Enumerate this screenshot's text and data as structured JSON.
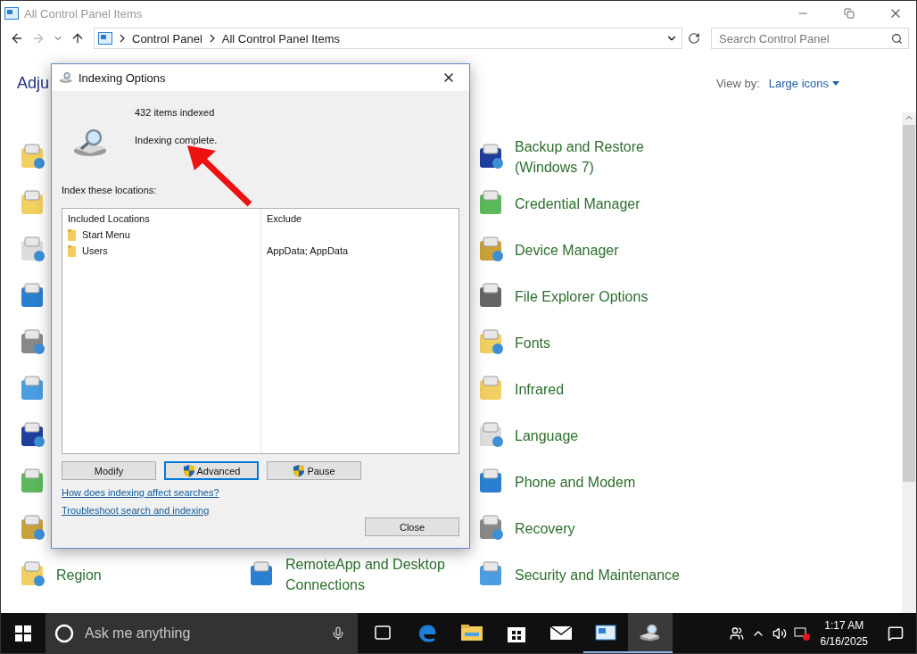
{
  "window": {
    "title": "All Control Panel Items",
    "address": [
      "Control Panel",
      "All Control Panel Items"
    ],
    "search_placeholder": "Search Control Panel"
  },
  "header": {
    "title": "Adju",
    "view_by_label": "View by:",
    "view_by_value": "Large icons"
  },
  "items": {
    "column_1": [
      {
        "label": "Region"
      }
    ],
    "column_2": [
      {
        "label": "RemoteApp and Desktop Connections"
      }
    ],
    "column_3": [
      {
        "label": "Backup and Restore (Windows 7)"
      },
      {
        "label": "Credential Manager"
      },
      {
        "label": "Device Manager"
      },
      {
        "label": "File Explorer Options"
      },
      {
        "label": "Fonts"
      },
      {
        "label": "Infrared"
      },
      {
        "label": "Language"
      },
      {
        "label": "Phone and Modem"
      },
      {
        "label": "Recovery"
      },
      {
        "label": "Security and Maintenance"
      }
    ]
  },
  "dialog": {
    "title": "Indexing Options",
    "count": "432 items indexed",
    "status": "Indexing complete.",
    "locations_label": "Index these locations:",
    "columns": [
      "Included Locations",
      "Exclude"
    ],
    "rows": [
      {
        "location": "Start Menu"
      },
      {
        "location": "Users",
        "exclude": "AppData; AppData"
      }
    ],
    "buttons": [
      {
        "label": "Modify",
        "shield": false,
        "focused": false
      },
      {
        "label": "Advanced",
        "shield": true,
        "focused": true
      },
      {
        "label": "Pause",
        "shield": true,
        "focused": false
      }
    ],
    "links": [
      "How does indexing affect searches?",
      "Troubleshoot search and indexing"
    ],
    "close": "Close"
  },
  "taskbar": {
    "search_placeholder": "Ask me anything",
    "apps": [
      {
        "kind": "taskview",
        "active": false,
        "selected": false
      },
      {
        "kind": "edge",
        "active": false,
        "selected": false
      },
      {
        "kind": "explorer",
        "active": false,
        "selected": false
      },
      {
        "kind": "store",
        "active": false,
        "selected": false
      },
      {
        "kind": "mail",
        "active": false,
        "selected": false
      },
      {
        "kind": "controlpanel",
        "active": true,
        "selected": false
      },
      {
        "kind": "indexing",
        "active": true,
        "selected": true
      }
    ],
    "time": "1:17 AM",
    "date": "6/16/2025"
  }
}
